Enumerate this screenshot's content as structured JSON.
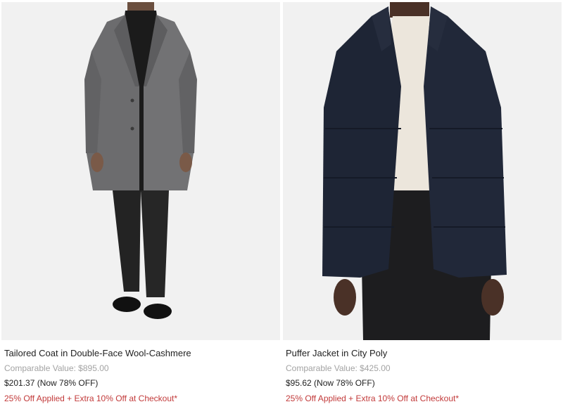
{
  "products": [
    {
      "title": "Tailored Coat in Double-Face Wool-Cashmere",
      "comparable": "Comparable Value: $895.00",
      "price": "$201.37 (Now 78% OFF)",
      "promo": "25% Off Applied + Extra 10% Off at Checkout*",
      "image_alt": "Model wearing a grey tailored wool-cashmere coat"
    },
    {
      "title": "Puffer Jacket in City Poly",
      "comparable": "Comparable Value: $425.00",
      "price": "$95.62 (Now 78% OFF)",
      "promo": "25% Off Applied + Extra 10% Off at Checkout*",
      "image_alt": "Model wearing a navy puffer jacket"
    }
  ],
  "colors": {
    "photo_bg": "#f1f1f1",
    "promo": "#c23a3a",
    "muted": "#a3a3a3",
    "text": "#222222"
  }
}
